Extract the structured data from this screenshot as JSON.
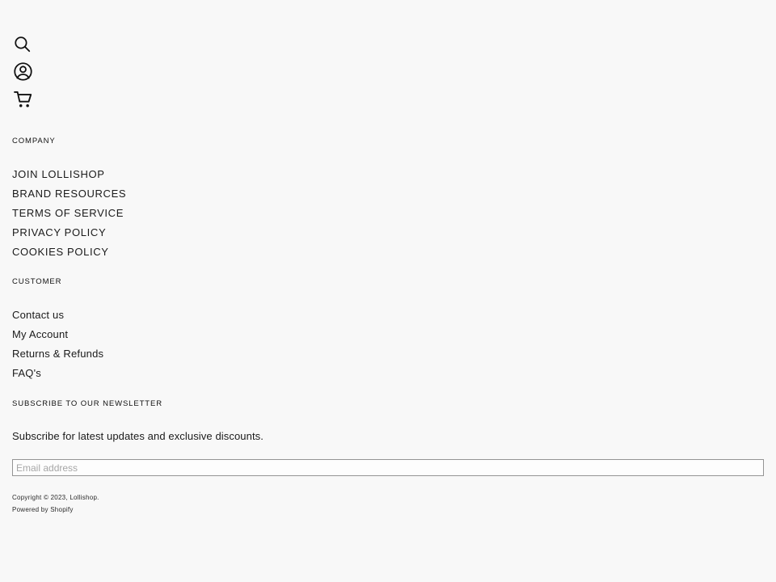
{
  "icon_rail": [
    {
      "name": "search-icon",
      "label": "Search"
    },
    {
      "name": "account-icon",
      "label": "Account"
    },
    {
      "name": "cart-icon",
      "label": "Cart"
    }
  ],
  "footer": {
    "company": {
      "heading": "COMPANY",
      "links": [
        "JOIN LOLLISHOP",
        "BRAND RESOURCES",
        "TERMS OF SERVICE",
        "PRIVACY POLICY",
        "COOKIES POLICY"
      ]
    },
    "customer": {
      "heading": "CUSTOMER",
      "links": [
        "Contact us",
        "My Account",
        "Returns & Refunds",
        "FAQ's"
      ]
    },
    "newsletter": {
      "heading": "SUBSCRIBE TO OUR NEWSLETTER",
      "description": "Subscribe for latest updates and exclusive discounts.",
      "email_placeholder": "Email address",
      "email_value": ""
    },
    "legal": {
      "copyright": "Copyright © 2023, Lollishop.",
      "powered_by": "Powered by Shopify"
    }
  },
  "colors": {
    "background": "#f8f8f8",
    "text": "#1a1a1a",
    "placeholder": "#a6a6a6",
    "input_border": "#949494"
  }
}
